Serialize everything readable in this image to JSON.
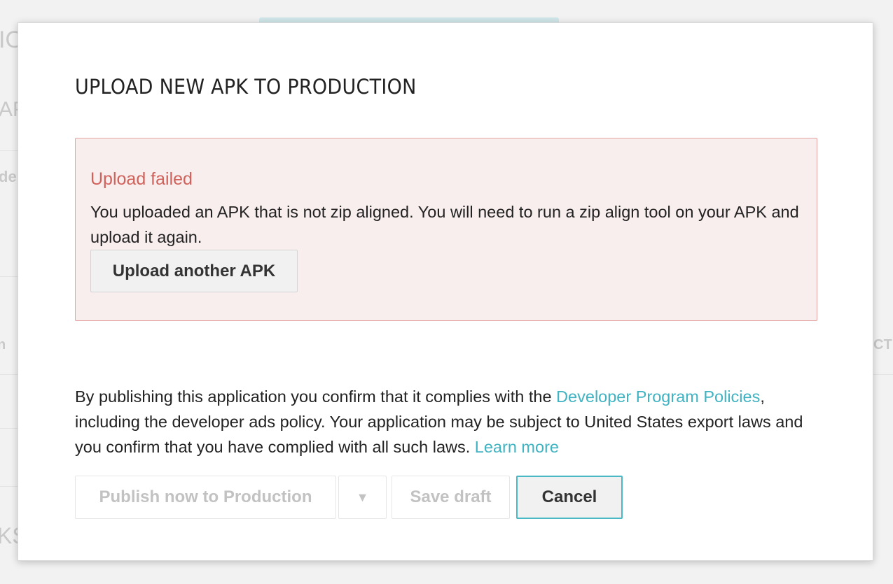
{
  "dialog": {
    "title": "UPLOAD NEW APK TO PRODUCTION"
  },
  "error": {
    "title": "Upload failed",
    "message": "You uploaded an APK that is not zip aligned. You will need to run a zip align tool on your APK and upload it again.",
    "upload_button": "Upload another APK"
  },
  "legal": {
    "text_before": "By publishing this application you confirm that it complies with the ",
    "policy_link": "Developer Program Policies",
    "text_middle": ", including the developer ads policy. Your application may be subject to United States export laws and you confirm that you have complied with all such laws. ",
    "learn_more_link": "Learn more"
  },
  "actions": {
    "publish_label": "Publish now to Production",
    "dropdown_icon": "▼",
    "save_draft_label": "Save draft",
    "cancel_label": "Cancel"
  },
  "background": {
    "fragments": [
      "IO",
      "AP",
      "de",
      "n",
      "CT",
      "KS"
    ]
  },
  "colors": {
    "accent": "#3fb3c2",
    "error_text": "#d0625b",
    "error_bg": "#f9eeee",
    "error_border": "#e4a3a3"
  }
}
